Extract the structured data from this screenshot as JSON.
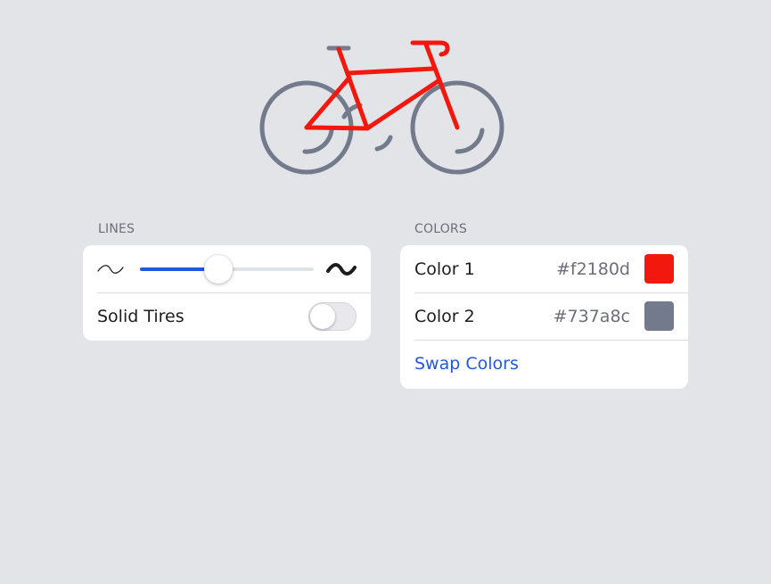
{
  "bike": {
    "frame_color": "#f2180d",
    "wheel_color": "#737a8c"
  },
  "lines": {
    "section_label": "LINES",
    "thickness_fraction": 0.45,
    "solid_tires_label": "Solid Tires",
    "solid_tires_on": false,
    "accent_color": "#2357e0"
  },
  "colors": {
    "section_label": "COLORS",
    "color1": {
      "label": "Color 1",
      "hex": "#f2180d"
    },
    "color2": {
      "label": "Color 2",
      "hex": "#737a8c"
    },
    "swap_label": "Swap Colors"
  }
}
